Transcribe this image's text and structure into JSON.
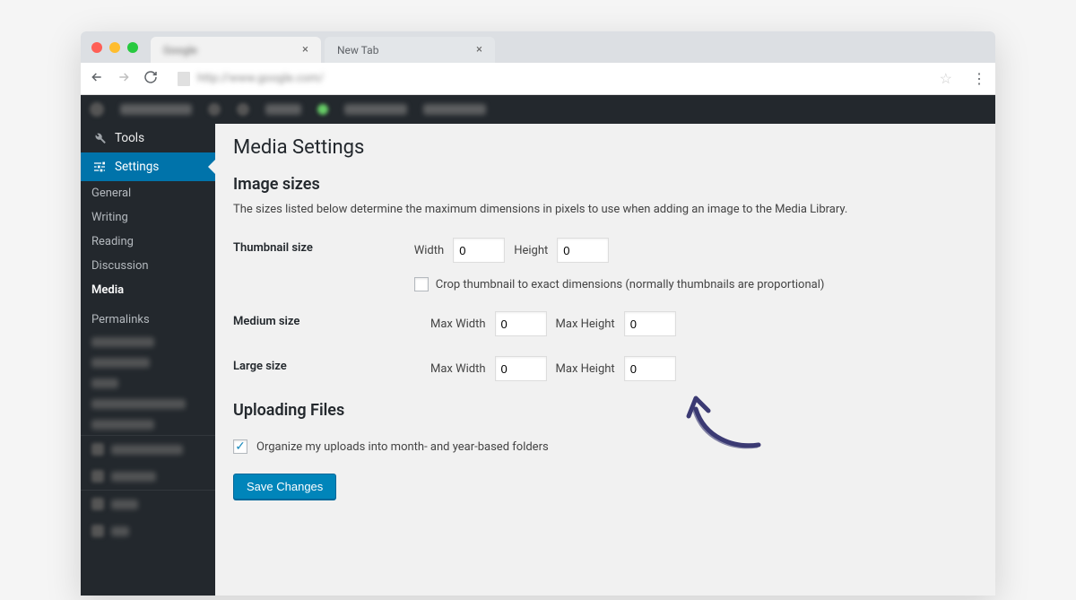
{
  "browser": {
    "tabs": [
      {
        "label": "Google",
        "blurred": true,
        "active": true
      },
      {
        "label": "New Tab",
        "blurred": false,
        "active": false
      }
    ],
    "url_blurred": "http://www.google.com/"
  },
  "sidebar": {
    "tools_label": "Tools",
    "settings_label": "Settings",
    "submenu": {
      "general": "General",
      "writing": "Writing",
      "reading": "Reading",
      "discussion": "Discussion",
      "media": "Media",
      "permalinks": "Permalinks"
    }
  },
  "page": {
    "title": "Media Settings",
    "section_image_sizes": "Image sizes",
    "image_sizes_desc": "The sizes listed below determine the maximum dimensions in pixels to use when adding an image to the Media Library.",
    "thumb_label": "Thumbnail size",
    "width_label": "Width",
    "height_label": "Height",
    "thumb_width": "0",
    "thumb_height": "0",
    "crop_label": "Crop thumbnail to exact dimensions (normally thumbnails are proportional)",
    "crop_checked": false,
    "medium_label": "Medium size",
    "large_label": "Large size",
    "maxwidth_label": "Max Width",
    "maxheight_label": "Max Height",
    "medium_width": "0",
    "medium_height": "0",
    "large_width": "0",
    "large_height": "0",
    "section_uploading": "Uploading Files",
    "organize_label": "Organize my uploads into month- and year-based folders",
    "organize_checked": true,
    "save_button": "Save Changes"
  }
}
